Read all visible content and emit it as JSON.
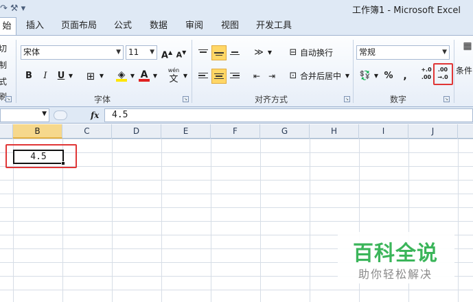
{
  "window": {
    "title": "工作簿1  -  Microsoft Excel"
  },
  "qat": {
    "undo_icon": "undo-icon",
    "customize_icon": "customize-icon"
  },
  "tabs": [
    {
      "label": "始",
      "active": true
    },
    {
      "label": "插入"
    },
    {
      "label": "页面布局"
    },
    {
      "label": "公式"
    },
    {
      "label": "数据"
    },
    {
      "label": "审阅"
    },
    {
      "label": "视图"
    },
    {
      "label": "开发工具"
    }
  ],
  "clipboard": {
    "cut": "切",
    "copy": "制",
    "painter": "式刷"
  },
  "font": {
    "name": "宋体",
    "size": "11",
    "grow": "A",
    "shrink": "A",
    "bold": "B",
    "italic": "I",
    "underline": "U",
    "color_letter": "A",
    "phonetic": "wén",
    "phonetic_char": "文",
    "group_label": "字体"
  },
  "alignment": {
    "wrap_label": "自动换行",
    "merge_label": "合并后居中",
    "group_label": "对齐方式"
  },
  "number": {
    "format": "常规",
    "percent": "%",
    "comma": ",",
    "inc_decimal_top": "+.0",
    "inc_decimal_bottom": ".00",
    "dec_decimal_top": ".00",
    "dec_decimal_bottom": "→.0",
    "group_label": "数字"
  },
  "styles": {
    "conditional_label": "条件"
  },
  "formula_bar": {
    "fx": "fx",
    "value": "4.5"
  },
  "columns": [
    "B",
    "C",
    "D",
    "E",
    "F",
    "G",
    "H",
    "I",
    "J"
  ],
  "active_column": "B",
  "active_cell": {
    "value": "4.5"
  },
  "watermark": {
    "main": "百科全说",
    "sub": "助你轻松解决"
  },
  "colors": {
    "highlight": "#e03535",
    "ribbon": "#dfe9f5",
    "fill_yellow": "#ffe600",
    "font_red": "#e02020",
    "watermark_green": "#3bb55a"
  }
}
